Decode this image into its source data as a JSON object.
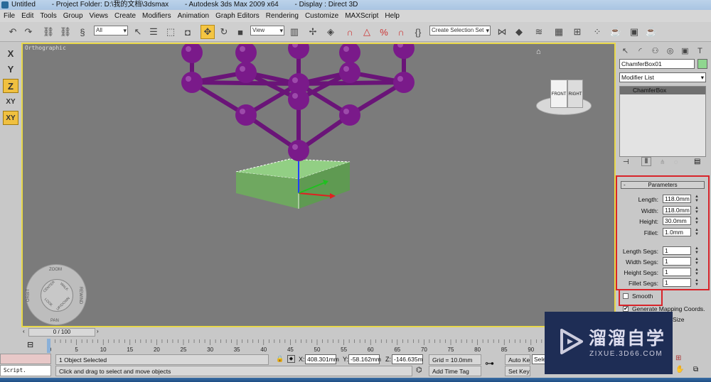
{
  "titlebar": {
    "parts": [
      "Untitled",
      "- Project Folder: D:\\我的文档\\3dsmax",
      "- Autodesk 3ds Max  2009 x64",
      "- Display : Direct 3D"
    ]
  },
  "menu": [
    "File",
    "Edit",
    "Tools",
    "Group",
    "Views",
    "Create",
    "Modifiers",
    "Animation",
    "Graph Editors",
    "Rendering",
    "Customize",
    "MAXScript",
    "Help"
  ],
  "toolbar": {
    "selection_filter": "All",
    "ref_coord": "View",
    "selection_set_placeholder": "Create Selection Set",
    "active_tool": "select-and-move"
  },
  "axis_constraints": [
    "X",
    "Y",
    "Z",
    "XY",
    "XY"
  ],
  "axis_active": [
    "Z",
    "XY"
  ],
  "viewport": {
    "label": "Orthographic",
    "viewcube": {
      "front": "FRONT",
      "right": "RIGHT"
    },
    "nav_wheel": {
      "zoom": "ZOOM",
      "orbit": "ORBIT",
      "rewind": "REWIND",
      "pan": "PAN",
      "center": "CENTER",
      "walk": "WALK",
      "look": "LOOK",
      "updown": "UP/DOWN"
    },
    "colors": {
      "molecule": "#7a1a8a",
      "box": "#7fbf6f",
      "border": "#e8d84a"
    }
  },
  "command_panel": {
    "object_name": "ChamferBox01",
    "object_color": "#8fd68f",
    "modifier_list": "Modifier List",
    "stack": [
      "ChamferBox"
    ],
    "rollout": "Parameters",
    "params": [
      {
        "label": "Length:",
        "value": "118.0mm"
      },
      {
        "label": "Width:",
        "value": "118.0mm"
      },
      {
        "label": "Height:",
        "value": "30.0mm"
      },
      {
        "label": "Fillet:",
        "value": "1.0mm"
      }
    ],
    "segs": [
      {
        "label": "Length Segs:",
        "value": "1"
      },
      {
        "label": "Width Segs:",
        "value": "1"
      },
      {
        "label": "Height Segs:",
        "value": "1"
      },
      {
        "label": "Fillet Segs:",
        "value": "1"
      }
    ],
    "smooth": {
      "label": "Smooth",
      "checked": false
    },
    "gen_mapping": {
      "label": "Generate Mapping Coords.",
      "checked": true
    },
    "real_world": "Size"
  },
  "timeline": {
    "position": "0 / 100",
    "ticks": [
      "0",
      "5",
      "10",
      "15",
      "20",
      "25",
      "30",
      "35",
      "40",
      "45",
      "50",
      "55",
      "60",
      "65",
      "70",
      "75",
      "80",
      "85",
      "90"
    ]
  },
  "status": {
    "selected": "1 Object Selected",
    "prompt": "Click and drag to select and move objects",
    "x": "408.301mm",
    "y": "-58.162mm",
    "z": "-146.635mm",
    "x_label": "X:",
    "y_label": "Y:",
    "z_label": "Z:",
    "grid": "Grid = 10.0mm",
    "add_time_tag": "Add Time Tag",
    "auto_key": "Auto Key",
    "set_key": "Set Key",
    "key_filter": "Sele",
    "script": "Script."
  },
  "watermark": {
    "title": "溜溜自学",
    "url": "ZIXUE.3D66.COM"
  }
}
